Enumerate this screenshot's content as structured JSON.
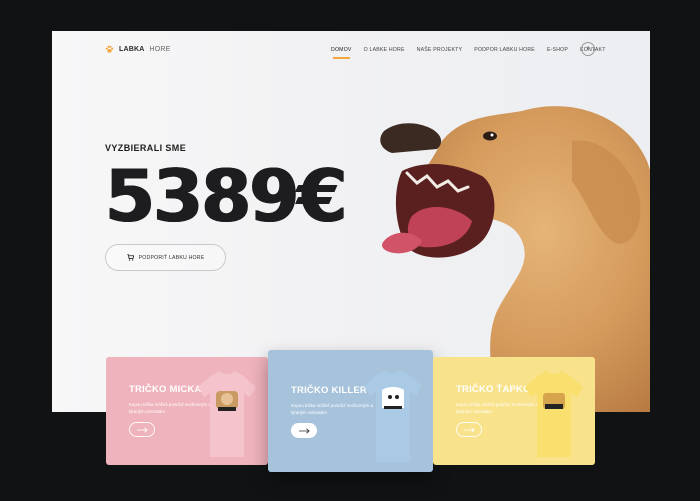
{
  "nav": {
    "logo_bold": "LABKA",
    "logo_light": "HORE",
    "items": [
      {
        "label": "DOMOV",
        "active": true
      },
      {
        "label": "O LABKE HORE",
        "active": false
      },
      {
        "label": "NAŠE PROJEKTY",
        "active": false
      },
      {
        "label": "PODPOR LABKU HORE",
        "active": false
      },
      {
        "label": "E-SHOP",
        "active": false
      },
      {
        "label": "KONTAKT",
        "active": false
      }
    ],
    "social": "f"
  },
  "hero": {
    "subtitle": "VYZBIERALI SME",
    "amount": "5389€",
    "cta_label": "PODPORIŤ LABKU HORE"
  },
  "cards": [
    {
      "title": "TRIČKO MICKA",
      "description": "Kupou trička môžeš pomôcť nechceným a týraným zvieratám",
      "color": "#efb3bd",
      "shirt_color": "#f5c3cc"
    },
    {
      "title": "TRIČKO KILLER",
      "description": "Kupou trička môžeš pomôcť nechceným a týraným zvieratám",
      "color": "#a7c3db",
      "shirt_color": "#a9c9e4"
    },
    {
      "title": "TRIČKO ŤAPKO",
      "description": "Kupou trička môžeš pomôcť nechceným a týraným zvieratám",
      "color": "#f8e28b",
      "shirt_color": "#f9e06e"
    }
  ],
  "colors": {
    "accent": "#f2a63b",
    "background": "#111213"
  }
}
